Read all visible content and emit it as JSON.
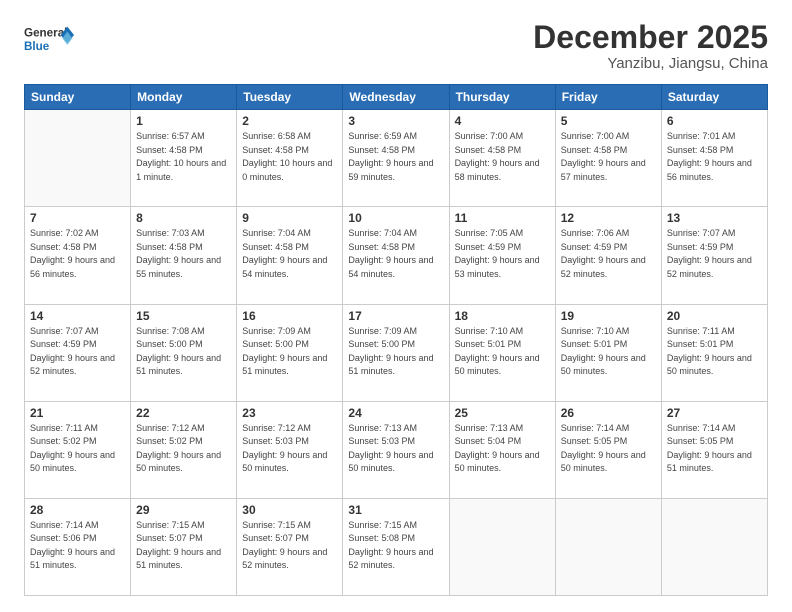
{
  "logo": {
    "line1": "General",
    "line2": "Blue"
  },
  "title": "December 2025",
  "subtitle": "Yanzibu, Jiangsu, China",
  "days_header": [
    "Sunday",
    "Monday",
    "Tuesday",
    "Wednesday",
    "Thursday",
    "Friday",
    "Saturday"
  ],
  "weeks": [
    [
      {
        "num": "",
        "empty": true
      },
      {
        "num": "1",
        "sunrise": "6:57 AM",
        "sunset": "4:58 PM",
        "daylight": "10 hours and 1 minute."
      },
      {
        "num": "2",
        "sunrise": "6:58 AM",
        "sunset": "4:58 PM",
        "daylight": "10 hours and 0 minutes."
      },
      {
        "num": "3",
        "sunrise": "6:59 AM",
        "sunset": "4:58 PM",
        "daylight": "9 hours and 59 minutes."
      },
      {
        "num": "4",
        "sunrise": "7:00 AM",
        "sunset": "4:58 PM",
        "daylight": "9 hours and 58 minutes."
      },
      {
        "num": "5",
        "sunrise": "7:00 AM",
        "sunset": "4:58 PM",
        "daylight": "9 hours and 57 minutes."
      },
      {
        "num": "6",
        "sunrise": "7:01 AM",
        "sunset": "4:58 PM",
        "daylight": "9 hours and 56 minutes."
      }
    ],
    [
      {
        "num": "7",
        "sunrise": "7:02 AM",
        "sunset": "4:58 PM",
        "daylight": "9 hours and 56 minutes."
      },
      {
        "num": "8",
        "sunrise": "7:03 AM",
        "sunset": "4:58 PM",
        "daylight": "9 hours and 55 minutes."
      },
      {
        "num": "9",
        "sunrise": "7:04 AM",
        "sunset": "4:58 PM",
        "daylight": "9 hours and 54 minutes."
      },
      {
        "num": "10",
        "sunrise": "7:04 AM",
        "sunset": "4:58 PM",
        "daylight": "9 hours and 54 minutes."
      },
      {
        "num": "11",
        "sunrise": "7:05 AM",
        "sunset": "4:59 PM",
        "daylight": "9 hours and 53 minutes."
      },
      {
        "num": "12",
        "sunrise": "7:06 AM",
        "sunset": "4:59 PM",
        "daylight": "9 hours and 52 minutes."
      },
      {
        "num": "13",
        "sunrise": "7:07 AM",
        "sunset": "4:59 PM",
        "daylight": "9 hours and 52 minutes."
      }
    ],
    [
      {
        "num": "14",
        "sunrise": "7:07 AM",
        "sunset": "4:59 PM",
        "daylight": "9 hours and 52 minutes."
      },
      {
        "num": "15",
        "sunrise": "7:08 AM",
        "sunset": "5:00 PM",
        "daylight": "9 hours and 51 minutes."
      },
      {
        "num": "16",
        "sunrise": "7:09 AM",
        "sunset": "5:00 PM",
        "daylight": "9 hours and 51 minutes."
      },
      {
        "num": "17",
        "sunrise": "7:09 AM",
        "sunset": "5:00 PM",
        "daylight": "9 hours and 51 minutes."
      },
      {
        "num": "18",
        "sunrise": "7:10 AM",
        "sunset": "5:01 PM",
        "daylight": "9 hours and 50 minutes."
      },
      {
        "num": "19",
        "sunrise": "7:10 AM",
        "sunset": "5:01 PM",
        "daylight": "9 hours and 50 minutes."
      },
      {
        "num": "20",
        "sunrise": "7:11 AM",
        "sunset": "5:01 PM",
        "daylight": "9 hours and 50 minutes."
      }
    ],
    [
      {
        "num": "21",
        "sunrise": "7:11 AM",
        "sunset": "5:02 PM",
        "daylight": "9 hours and 50 minutes."
      },
      {
        "num": "22",
        "sunrise": "7:12 AM",
        "sunset": "5:02 PM",
        "daylight": "9 hours and 50 minutes."
      },
      {
        "num": "23",
        "sunrise": "7:12 AM",
        "sunset": "5:03 PM",
        "daylight": "9 hours and 50 minutes."
      },
      {
        "num": "24",
        "sunrise": "7:13 AM",
        "sunset": "5:03 PM",
        "daylight": "9 hours and 50 minutes."
      },
      {
        "num": "25",
        "sunrise": "7:13 AM",
        "sunset": "5:04 PM",
        "daylight": "9 hours and 50 minutes."
      },
      {
        "num": "26",
        "sunrise": "7:14 AM",
        "sunset": "5:05 PM",
        "daylight": "9 hours and 50 minutes."
      },
      {
        "num": "27",
        "sunrise": "7:14 AM",
        "sunset": "5:05 PM",
        "daylight": "9 hours and 51 minutes."
      }
    ],
    [
      {
        "num": "28",
        "sunrise": "7:14 AM",
        "sunset": "5:06 PM",
        "daylight": "9 hours and 51 minutes."
      },
      {
        "num": "29",
        "sunrise": "7:15 AM",
        "sunset": "5:07 PM",
        "daylight": "9 hours and 51 minutes."
      },
      {
        "num": "30",
        "sunrise": "7:15 AM",
        "sunset": "5:07 PM",
        "daylight": "9 hours and 52 minutes."
      },
      {
        "num": "31",
        "sunrise": "7:15 AM",
        "sunset": "5:08 PM",
        "daylight": "9 hours and 52 minutes."
      },
      {
        "num": "",
        "empty": true
      },
      {
        "num": "",
        "empty": true
      },
      {
        "num": "",
        "empty": true
      }
    ]
  ]
}
